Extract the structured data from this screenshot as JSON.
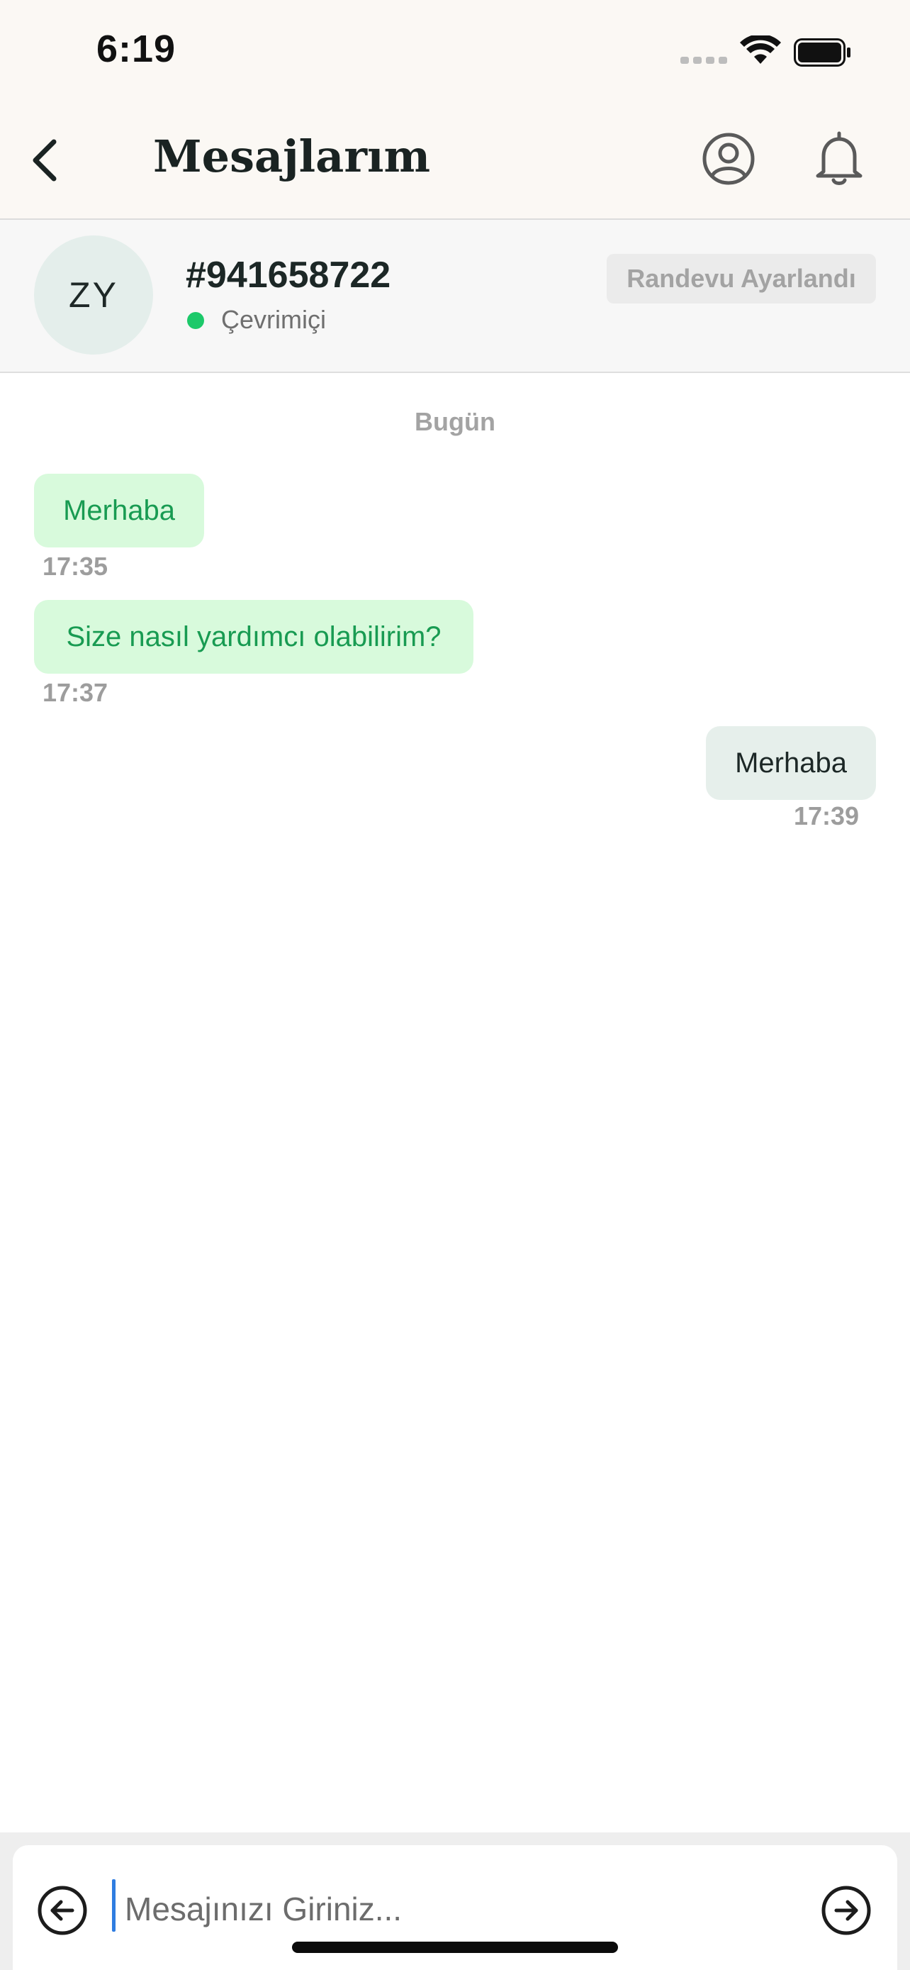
{
  "status_bar": {
    "time": "6:19",
    "icons": [
      "cellular-signal-icon",
      "wifi-icon",
      "battery-icon"
    ]
  },
  "nav": {
    "back_icon": "chevron-left-icon",
    "title": "Mesajlarım",
    "actions": [
      "profile-icon",
      "bell-icon"
    ]
  },
  "conversation": {
    "avatar_initials": "ZY",
    "id": "#941658722",
    "presence": "Çevrimiçi",
    "presence_color": "#1cc96a",
    "status_badge": "Randevu Ayarlandı"
  },
  "date_separator": "Bugün",
  "messages": [
    {
      "direction": "incoming",
      "text": "Merhaba",
      "time": "17:35"
    },
    {
      "direction": "incoming",
      "text": "Size nasıl yardımcı olabilirim?",
      "time": "17:37"
    },
    {
      "direction": "outgoing",
      "text": "Merhaba",
      "time": "17:39"
    }
  ],
  "composer": {
    "value": "",
    "placeholder": "Mesajınızı Giriniz...",
    "left_icon": "arrow-left-circle-icon",
    "send_icon": "arrow-right-circle-icon"
  },
  "colors": {
    "incoming_bubble": "#d8fadc",
    "incoming_text": "#189b52",
    "outgoing_bubble": "#e6efeb",
    "header_background": "#fbf8f4"
  }
}
